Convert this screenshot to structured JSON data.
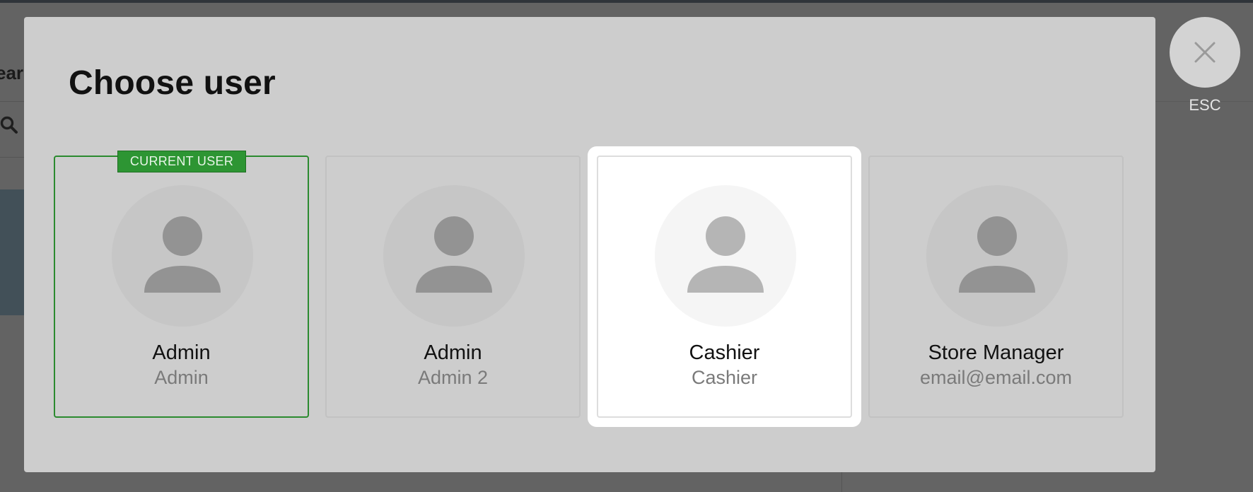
{
  "modal": {
    "title": "Choose user",
    "close_label": "ESC"
  },
  "users": [
    {
      "name": "Admin",
      "subtitle": "Admin",
      "badge": "CURRENT USER"
    },
    {
      "name": "Admin",
      "subtitle": "Admin 2"
    },
    {
      "name": "Cashier",
      "subtitle": "Cashier"
    },
    {
      "name": "Store Manager",
      "subtitle": "email@email.com"
    }
  ],
  "background": {
    "partial_heading": "ear"
  },
  "colors": {
    "current_user_accent": "#2d9533",
    "modal_background": "#cdcdcd",
    "overlay": "#636363"
  },
  "icons": {
    "avatar": "user-silhouette-icon",
    "close": "close-icon",
    "search": "search-icon"
  }
}
